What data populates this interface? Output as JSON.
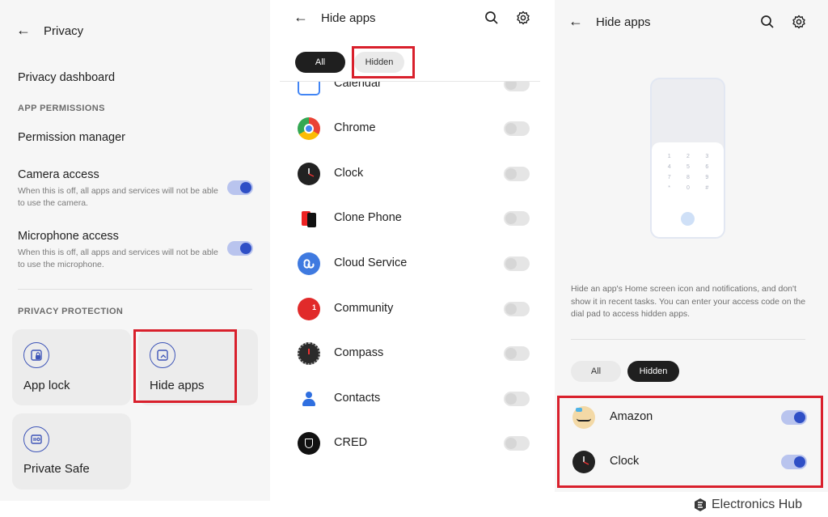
{
  "privacy": {
    "title": "Privacy",
    "dashboard": "Privacy dashboard",
    "app_permissions_header": "APP PERMISSIONS",
    "permission_manager": "Permission manager",
    "camera": {
      "title": "Camera access",
      "desc": "When this is off, all apps and services will not be able to use the camera.",
      "enabled": true
    },
    "microphone": {
      "title": "Microphone access",
      "desc": "When this is off, all apps and services will not be able to use the microphone.",
      "enabled": true
    },
    "privacy_protection_header": "PRIVACY PROTECTION",
    "cards": {
      "app_lock": "App lock",
      "hide_apps": "Hide apps",
      "private_safe": "Private Safe"
    }
  },
  "hide_apps_all": {
    "title": "Hide apps",
    "tab_all": "All",
    "tab_hidden": "Hidden",
    "apps": [
      {
        "name": "Calendar",
        "enabled": false
      },
      {
        "name": "Chrome",
        "enabled": false
      },
      {
        "name": "Clock",
        "enabled": false
      },
      {
        "name": "Clone Phone",
        "enabled": false
      },
      {
        "name": "Cloud Service",
        "enabled": false
      },
      {
        "name": "Community",
        "enabled": false,
        "badge": "1"
      },
      {
        "name": "Compass",
        "enabled": false
      },
      {
        "name": "Contacts",
        "enabled": false
      },
      {
        "name": "CRED",
        "enabled": false
      }
    ]
  },
  "hide_apps_hidden": {
    "title": "Hide apps",
    "dialpad_keys": [
      "1",
      "2",
      "3",
      "4",
      "5",
      "6",
      "7",
      "8",
      "9",
      "*",
      "0",
      "#"
    ],
    "description": "Hide an app's Home screen icon and notifications, and don't show it in recent tasks. You can enter your access code on the dial pad to access hidden apps.",
    "tab_all": "All",
    "tab_hidden": "Hidden",
    "apps": [
      {
        "name": "Amazon",
        "enabled": true
      },
      {
        "name": "Clock",
        "enabled": true
      }
    ]
  },
  "watermark": "Electronics Hub",
  "colors": {
    "accent": "#2f4fc6",
    "highlight": "#d9202c"
  }
}
